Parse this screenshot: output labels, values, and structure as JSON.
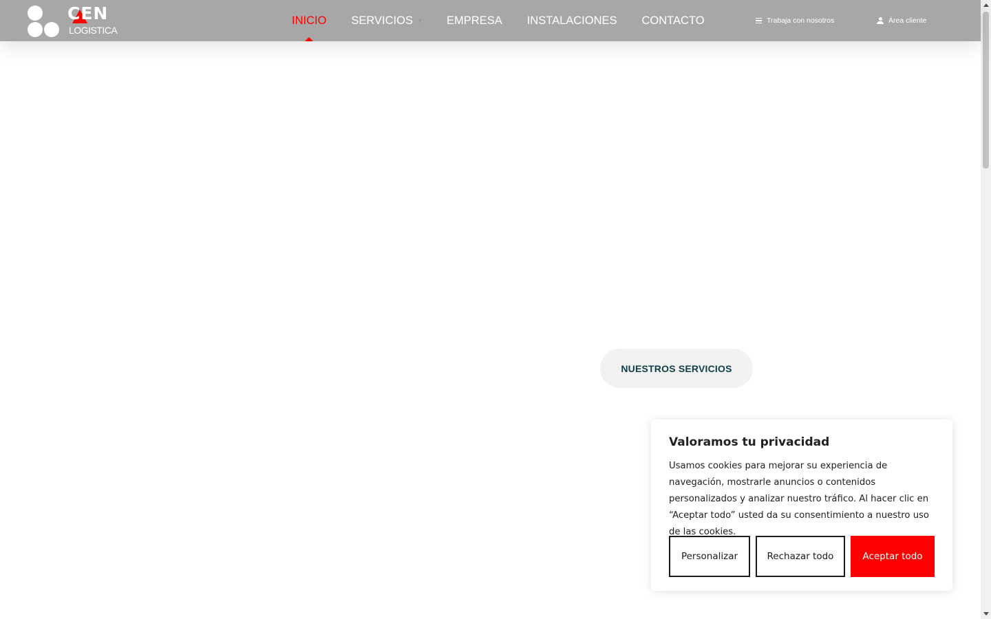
{
  "header": {
    "logo": {
      "brand": "CEN",
      "sub": "LOGISTICA"
    },
    "nav": [
      {
        "label": "INICIO",
        "active": true
      },
      {
        "label": "SERVICIOS",
        "has_dropdown": true
      },
      {
        "label": "EMPRESA"
      },
      {
        "label": "INSTALACIONES"
      },
      {
        "label": "CONTACTO"
      }
    ],
    "jobs_label": "Trabaja con nosotros",
    "client_label": "Área cliente"
  },
  "hero": {
    "services_button": "NUESTROS SERVICIOS"
  },
  "cookie_banner": {
    "title": "Valoramos tu privacidad",
    "text": "Usamos cookies para mejorar su experiencia de navegación, mostrarle anuncios o contenidos personalizados y analizar nuestro tráfico. Al hacer clic en “Aceptar todo” usted da su consentimiento a nuestro uso de las cookies.",
    "customize": "Personalizar",
    "reject": "Rechazar todo",
    "accept": "Aceptar todo"
  },
  "colors": {
    "header_bg": "#a7a7a7",
    "accent": "#ff0000",
    "button_text": "#0f3d47"
  },
  "icons": [
    "menu-icon",
    "user-icon",
    "chevron-down-icon"
  ]
}
